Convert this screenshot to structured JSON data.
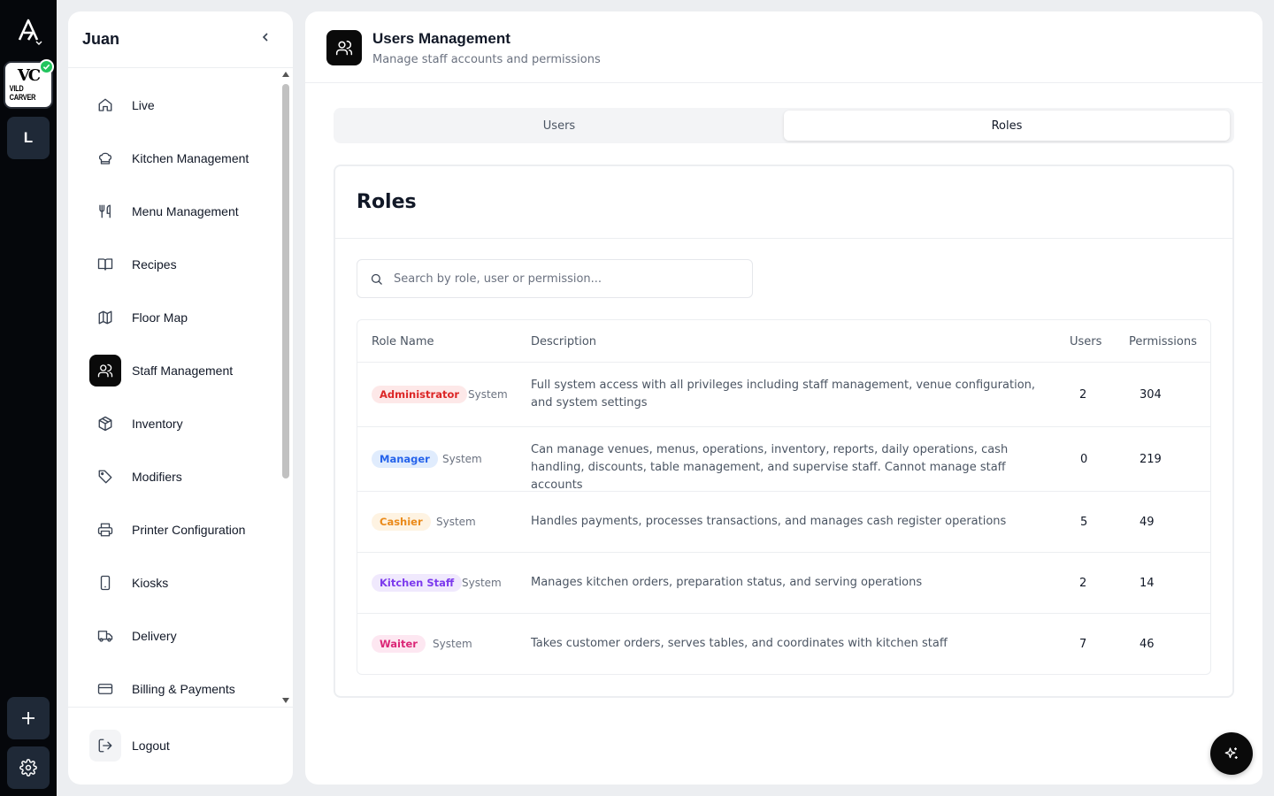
{
  "rail": {
    "logo_icon": "app-logo-icon",
    "venue": {
      "monogram": "VC",
      "name": "VILD CARVER",
      "status_icon": "verified-check-icon"
    },
    "workspace_initial": "L",
    "add_icon": "plus-icon",
    "settings_icon": "gear-icon"
  },
  "sidebar": {
    "title": "Juan",
    "collapse_icon": "chevron-left-icon",
    "items": [
      {
        "label": "Live",
        "icon": "home-icon",
        "active": false
      },
      {
        "label": "Kitchen Management",
        "icon": "chef-hat-icon",
        "active": false
      },
      {
        "label": "Menu Management",
        "icon": "utensils-icon",
        "active": false
      },
      {
        "label": "Recipes",
        "icon": "book-open-icon",
        "active": false
      },
      {
        "label": "Floor Map",
        "icon": "map-icon",
        "active": false
      },
      {
        "label": "Staff Management",
        "icon": "users-icon",
        "active": true
      },
      {
        "label": "Inventory",
        "icon": "package-icon",
        "active": false
      },
      {
        "label": "Modifiers",
        "icon": "tag-icon",
        "active": false
      },
      {
        "label": "Printer Configuration",
        "icon": "printer-icon",
        "active": false
      },
      {
        "label": "Kiosks",
        "icon": "tablet-icon",
        "active": false
      },
      {
        "label": "Delivery",
        "icon": "truck-icon",
        "active": false
      },
      {
        "label": "Billing & Payments",
        "icon": "credit-card-icon",
        "active": false
      }
    ],
    "logout_label": "Logout"
  },
  "header": {
    "icon": "users-icon",
    "title": "Users Management",
    "subtitle": "Manage staff accounts and permissions"
  },
  "tabs": [
    {
      "label": "Users",
      "active": false
    },
    {
      "label": "Roles",
      "active": true
    }
  ],
  "roles_card": {
    "title": "Roles",
    "search_placeholder": "Search by role, user or permission...",
    "columns": {
      "role_name": "Role Name",
      "description": "Description",
      "users": "Users",
      "permissions": "Permissions"
    },
    "rows": [
      {
        "role": "Administrator",
        "tag": "System",
        "description": "Full system access with all privileges including staff management, venue configuration, and system settings",
        "users": "2",
        "permissions": "304",
        "badge_bg": "#fde8e8",
        "badge_fg": "#dc2626"
      },
      {
        "role": "Manager",
        "tag": "System",
        "description": "Can manage venues, menus, operations, inventory, reports, daily operations, cash handling, discounts, table management, and supervise staff. Cannot manage staff accounts",
        "users": "0",
        "permissions": "219",
        "badge_bg": "#e0ecfd",
        "badge_fg": "#2563eb"
      },
      {
        "role": "Cashier",
        "tag": "System",
        "description": "Handles payments, processes transactions, and manages cash register operations",
        "users": "5",
        "permissions": "49",
        "badge_bg": "#fef3e2",
        "badge_fg": "#ea8a1a"
      },
      {
        "role": "Kitchen Staff",
        "tag": "System",
        "description": "Manages kitchen orders, preparation status, and serving operations",
        "users": "2",
        "permissions": "14",
        "badge_bg": "#f0e9fd",
        "badge_fg": "#7c3aed"
      },
      {
        "role": "Waiter",
        "tag": "System",
        "description": "Takes customer orders, serves tables, and coordinates with kitchen staff",
        "users": "7",
        "permissions": "46",
        "badge_bg": "#fde7f1",
        "badge_fg": "#db2777"
      }
    ]
  },
  "assistant_button_icon": "sparkles-icon"
}
